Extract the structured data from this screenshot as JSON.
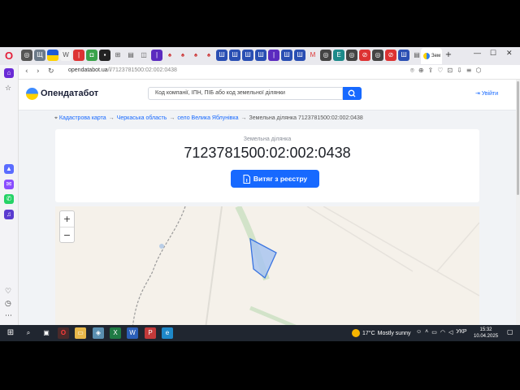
{
  "browser": {
    "active_tab_title": "Зем",
    "new_tab": "+",
    "url_main": "opendatabot.ua",
    "url_path": "/l/7123781500:02:002:0438",
    "back": "‹",
    "forward": "›",
    "reload": "↻"
  },
  "site": {
    "logo_text": "Опендатабот",
    "search_placeholder": "Код компанії, ІПН, ПІБ або код земельної ділянки",
    "login_label": "Увійти"
  },
  "breadcrumb": {
    "item1": "Кадастрова карта",
    "item2": "Черкаська область",
    "item3": "село Велика Яблунівка",
    "item4": "Земельна ділянка 7123781500:02:002:0438",
    "separator": "→"
  },
  "parcel": {
    "label": "Земельна ділянка",
    "number": "7123781500:02:002:0438",
    "extract_button": "Витяг з реєстру"
  },
  "map": {
    "zoom_in": "+",
    "zoom_out": "−"
  },
  "taskbar": {
    "weather_temp": "17°C",
    "weather_text": "Mostly sunny",
    "language": "УКР",
    "time": "15:32",
    "date": "10.04.2025"
  },
  "colors": {
    "brand_blue": "#1769ff",
    "parcel_fill": "#a9c6f0",
    "parcel_stroke": "#3a74e0"
  }
}
